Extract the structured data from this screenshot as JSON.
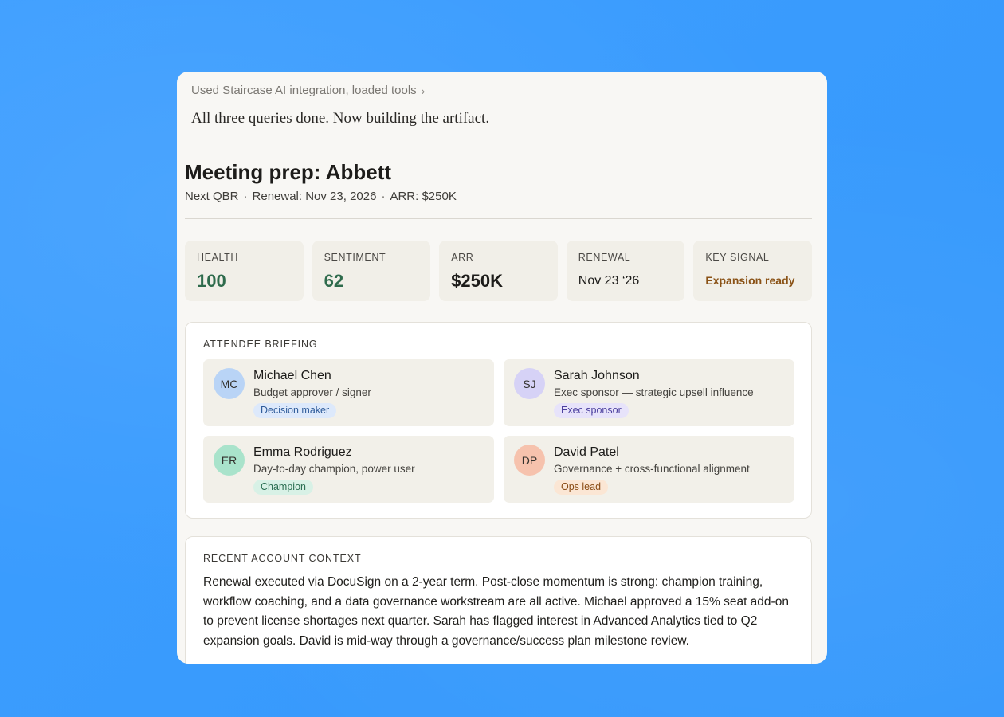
{
  "tool_line": {
    "text": "Used Staircase AI integration, loaded tools",
    "chevron": "›"
  },
  "status_line": "All three queries done. Now building the artifact.",
  "header": {
    "title": "Meeting prep: Abbett",
    "meta": [
      "Next QBR",
      "Renewal: Nov 23, 2026",
      "ARR: $250K"
    ],
    "separator": "·"
  },
  "stats": [
    {
      "label": "HEALTH",
      "value": "100"
    },
    {
      "label": "SENTIMENT",
      "value": "62"
    },
    {
      "label": "ARR",
      "value": "$250K"
    },
    {
      "label": "RENEWAL",
      "value": "Nov 23 ‘26"
    },
    {
      "label": "KEY SIGNAL",
      "value": "Expansion ready"
    }
  ],
  "attendees": {
    "title": "ATTENDEE BRIEFING",
    "people": [
      {
        "initials": "MC",
        "name": "Michael Chen",
        "role": "Budget approver / signer",
        "tag": "Decision maker",
        "avatar_color": "#b9d4f6",
        "tag_bg": "#dde9fb",
        "tag_color": "#2f5c9a"
      },
      {
        "initials": "SJ",
        "name": "Sarah Johnson",
        "role": "Exec sponsor — strategic upsell influence",
        "tag": "Exec sponsor",
        "avatar_color": "#d6d2f6",
        "tag_bg": "#e7e3fa",
        "tag_color": "#4b3f9e"
      },
      {
        "initials": "ER",
        "name": "Emma Rodriguez",
        "role": "Day-to-day champion, power user",
        "tag": "Champion",
        "avatar_color": "#a9e3cb",
        "tag_bg": "#d8f1e6",
        "tag_color": "#2a6e51"
      },
      {
        "initials": "DP",
        "name": "David Patel",
        "role": "Governance + cross-functional alignment",
        "tag": "Ops lead",
        "avatar_color": "#f6c2ad",
        "tag_bg": "#fbe6d4",
        "tag_color": "#8a4c15"
      }
    ]
  },
  "context": {
    "title": "RECENT ACCOUNT CONTEXT",
    "text": "Renewal executed via DocuSign on a 2-year term. Post-close momentum is strong: champion training, workflow coaching, and a data governance workstream are all active. Michael approved a 15% seat add-on to prevent license shortages next quarter. Sarah has flagged interest in Advanced Analytics tied to Q2 expansion goals. David is mid-way through a governance/success plan milestone review."
  }
}
